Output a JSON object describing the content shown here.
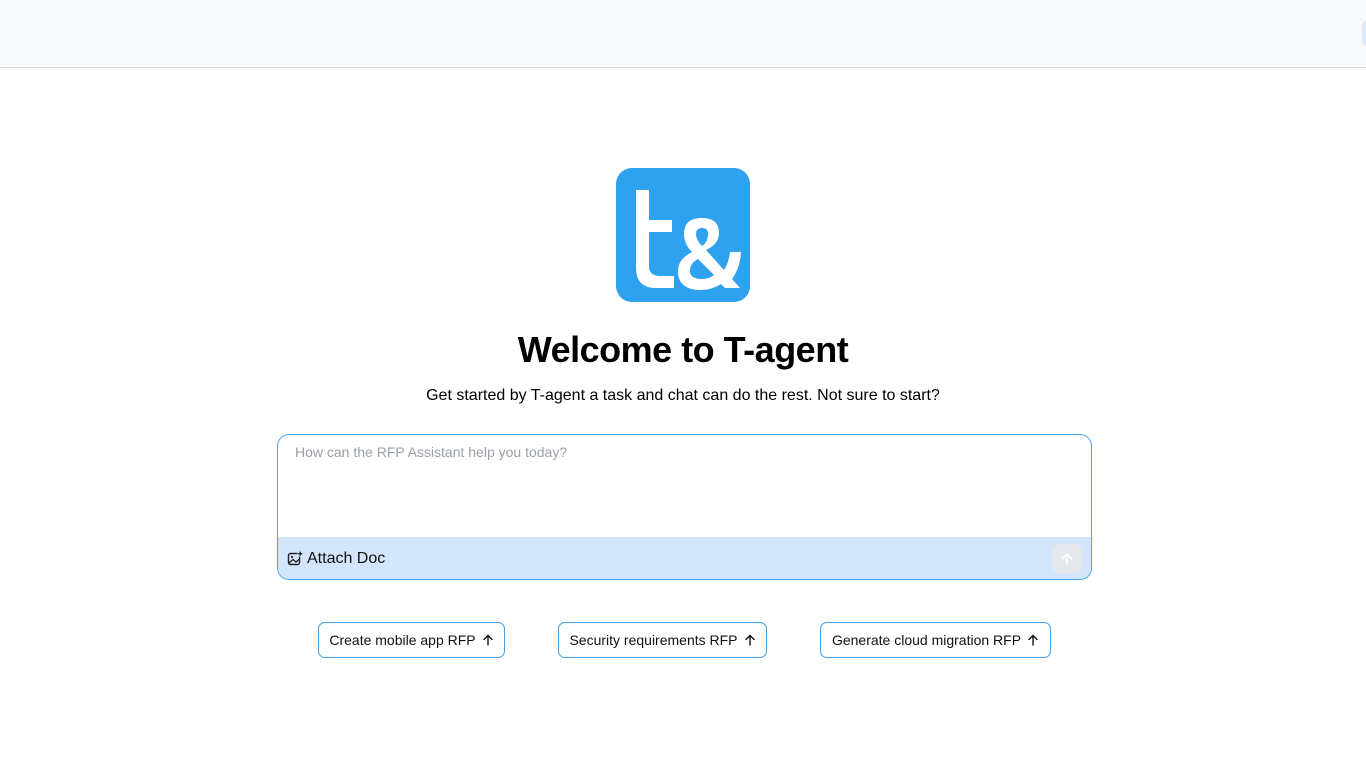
{
  "header": {},
  "logo": {
    "name": "t-agent-logo",
    "glyph": "t&",
    "color": "#2ea1ef"
  },
  "welcome": {
    "title": "Welcome to T-agent",
    "subtitle": "Get started by T-agent a task and chat can do the rest. Not sure to start?"
  },
  "composer": {
    "placeholder": "How can the RFP Assistant help you today?",
    "value": "",
    "attach_label": "Attach Doc",
    "attach_icon": "image-plus-icon",
    "send_icon": "arrow-up-icon"
  },
  "suggestions": [
    {
      "label": "Create mobile app RFP",
      "icon": "arrow-up-icon"
    },
    {
      "label": "Security requirements RFP",
      "icon": "arrow-up-icon"
    },
    {
      "label": "Generate cloud migration RFP",
      "icon": "arrow-up-icon"
    }
  ],
  "colors": {
    "accent": "#2ea1ef",
    "toolbar_bg": "#d2e5fb",
    "border": "#4aa7ee"
  }
}
